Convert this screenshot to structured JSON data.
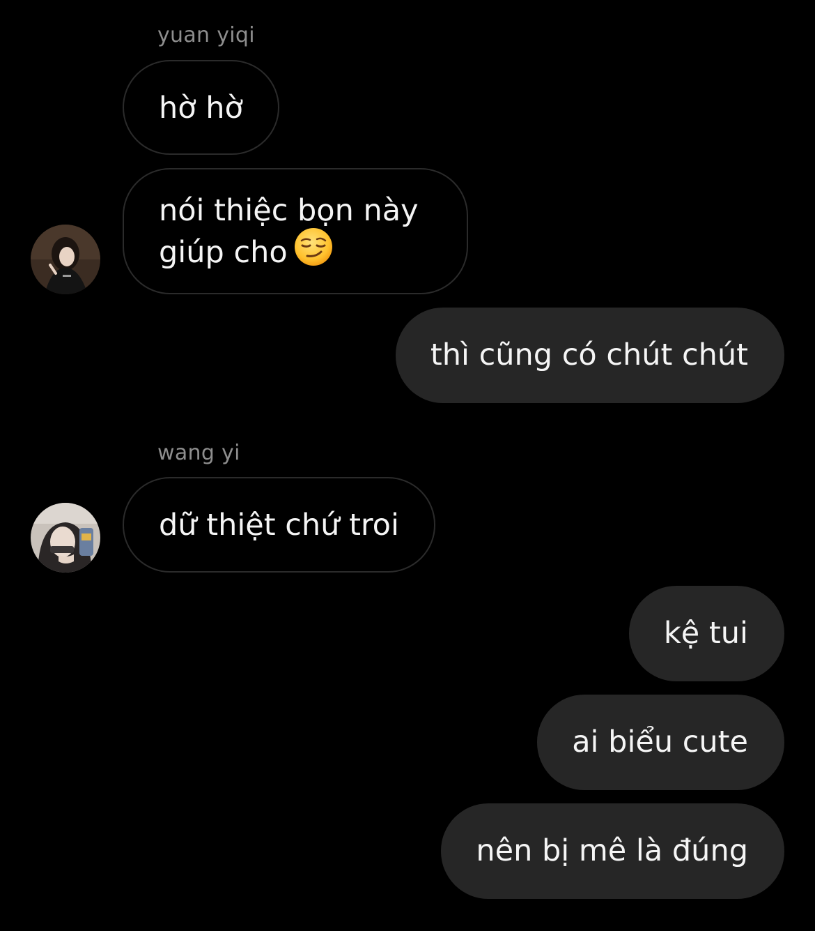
{
  "thread": {
    "groups": [
      {
        "sender": "yuan yiqi",
        "messages": [
          "hờ hờ",
          "nói thiệc bọn này",
          "giúp cho"
        ],
        "emoji": "smirk-emoji"
      },
      {
        "sender": "me",
        "messages": [
          "thì cũng có chút chút"
        ]
      },
      {
        "sender": "wang yi",
        "messages": [
          "dữ thiệt chứ troi"
        ]
      },
      {
        "sender": "me",
        "messages": [
          "kệ tui",
          "ai biểu cute",
          "nên bị mê là đúng"
        ]
      }
    ]
  },
  "colors": {
    "background": "#000000",
    "sent_bubble": "#262626",
    "received_border": "#2b2b2b",
    "text": "#f5f5f5",
    "sender_name": "#8e8e8e"
  },
  "icons": {
    "avatar_1": "avatar-yuan-yiqi",
    "avatar_2": "avatar-wang-yi",
    "emoji": "smirk-emoji"
  }
}
